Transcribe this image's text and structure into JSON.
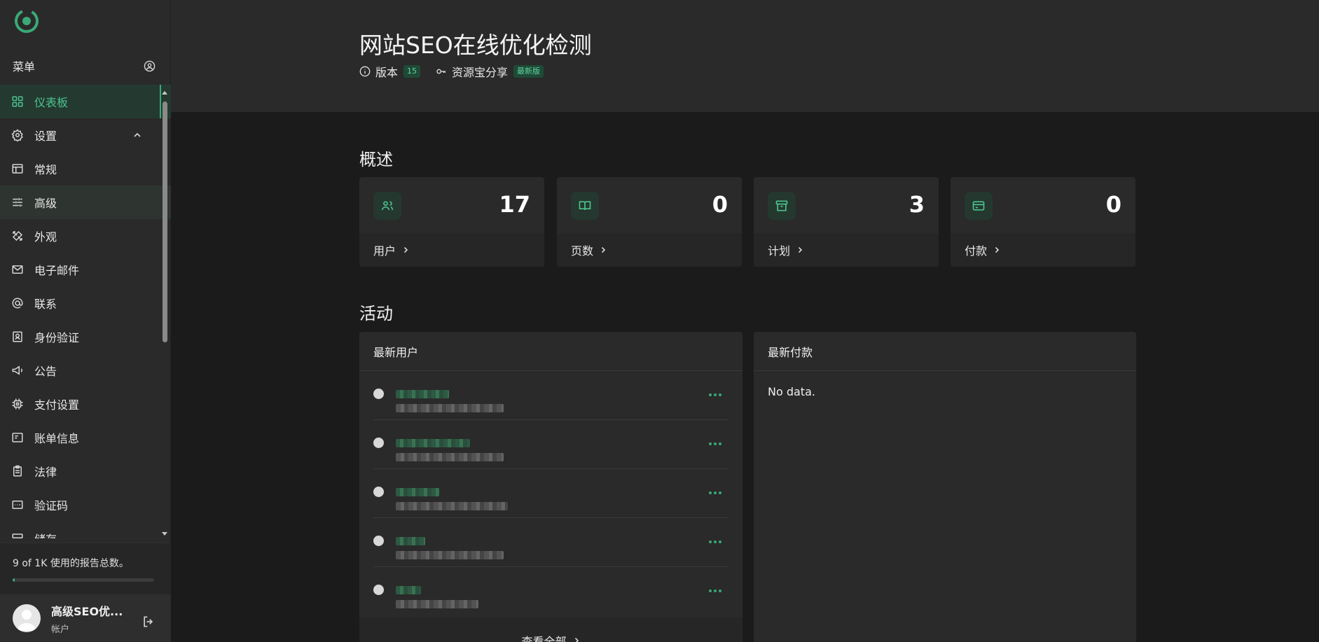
{
  "sidebar": {
    "menu_label": "菜单",
    "items": [
      {
        "label": "仪表板",
        "icon": "dashboard-grid-icon",
        "active": true
      },
      {
        "label": "设置",
        "icon": "gear-icon",
        "expanded": true
      },
      {
        "label": "常规",
        "icon": "window-icon"
      },
      {
        "label": "高级",
        "icon": "sliders-icon",
        "hovered": true
      },
      {
        "label": "外观",
        "icon": "brush-icon"
      },
      {
        "label": "电子邮件",
        "icon": "mail-icon"
      },
      {
        "label": "联系",
        "icon": "at-icon"
      },
      {
        "label": "身份验证",
        "icon": "id-badge-icon"
      },
      {
        "label": "公告",
        "icon": "megaphone-icon"
      },
      {
        "label": "支付设置",
        "icon": "chip-icon"
      },
      {
        "label": "账单信息",
        "icon": "invoice-icon"
      },
      {
        "label": "法律",
        "icon": "clipboard-icon"
      },
      {
        "label": "验证码",
        "icon": "captcha-icon"
      },
      {
        "label": "储存",
        "icon": "storage-icon"
      }
    ],
    "usage": {
      "text": "9 of 1K 使用的报告总数。",
      "fraction": 0.009
    },
    "account": {
      "name": "高级SEO优...",
      "role": "帐户"
    }
  },
  "header": {
    "title": "网站SEO在线优化检测",
    "version_label": "版本",
    "version_badge": "15",
    "license_label": "资源宝分享",
    "license_badge": "最新版"
  },
  "overview": {
    "title": "概述",
    "cards": [
      {
        "value": "17",
        "label": "用户",
        "icon": "users-icon"
      },
      {
        "value": "0",
        "label": "页数",
        "icon": "book-icon"
      },
      {
        "value": "3",
        "label": "计划",
        "icon": "package-icon"
      },
      {
        "value": "0",
        "label": "付款",
        "icon": "credit-card-icon"
      }
    ]
  },
  "activity": {
    "title": "活动",
    "users_panel": {
      "title": "最新用户",
      "view_all": "查看全部"
    },
    "payments_panel": {
      "title": "最新付款",
      "empty": "No data."
    }
  },
  "colors": {
    "accent": "#3aa877",
    "sidebar_bg": "#2a2a2a",
    "page_bg": "#1b1b1b"
  }
}
